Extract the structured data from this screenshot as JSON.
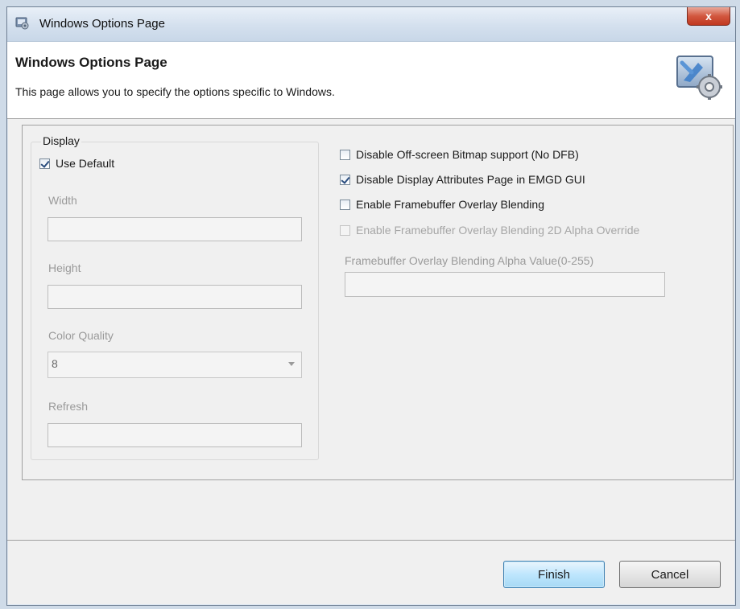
{
  "window": {
    "title": "Windows Options Page",
    "close_symbol": "x"
  },
  "banner": {
    "heading": "Windows Options Page",
    "description": "This page allows you to specify the options specific to Windows.",
    "icon": "wizard-settings-icon"
  },
  "display": {
    "legend": "Display",
    "use_default": {
      "label": "Use Default",
      "checked": true
    },
    "width": {
      "label": "Width",
      "value": ""
    },
    "height": {
      "label": "Height",
      "value": ""
    },
    "color_quality": {
      "label": "Color Quality",
      "value": "8"
    },
    "refresh": {
      "label": "Refresh",
      "value": ""
    }
  },
  "options": [
    {
      "label": "Disable Off-screen Bitmap support (No DFB)",
      "checked": false,
      "enabled": true
    },
    {
      "label": "Disable Display Attributes Page in EMGD GUI",
      "checked": true,
      "enabled": true
    },
    {
      "label": "Enable Framebuffer Overlay Blending",
      "checked": false,
      "enabled": true
    },
    {
      "label": "Enable Framebuffer Overlay Blending 2D Alpha Override",
      "checked": false,
      "enabled": false
    }
  ],
  "alpha": {
    "label": "Framebuffer Overlay Blending  Alpha Value(0-255)",
    "value": ""
  },
  "buttons": {
    "finish": "Finish",
    "cancel": "Cancel"
  },
  "colors": {
    "accent": "#3c7fb1",
    "disabled_text": "#9a9a9a"
  }
}
